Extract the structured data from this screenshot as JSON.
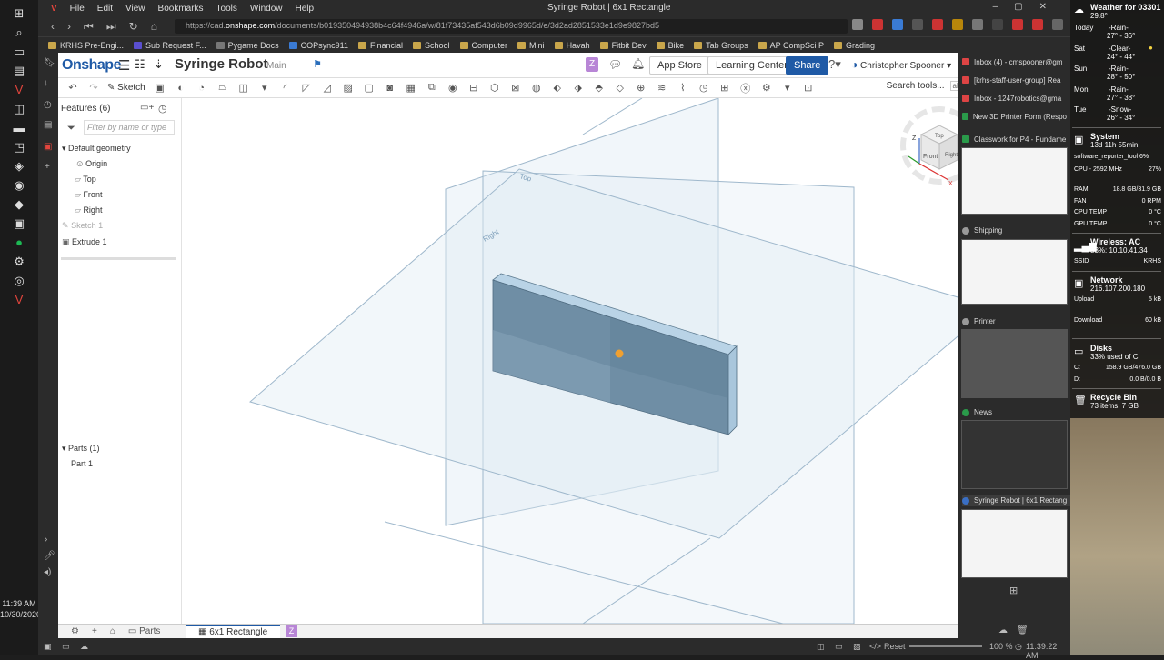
{
  "taskbar": {
    "clock_time": "11:39 AM",
    "clock_date": "10/30/2020"
  },
  "browser": {
    "menu": [
      "File",
      "Edit",
      "View",
      "Bookmarks",
      "Tools",
      "Window",
      "Help"
    ],
    "window_title": "Syringe Robot | 6x1 Rectangle",
    "url_prefix": "https://cad.",
    "url_domain": "onshape.com",
    "url_path": "/documents/b019350494938b4c64f4946a/w/81f73435af543d6b09d9965d/e/3d2ad2851533e1d9e9827bd5",
    "bookmarks": [
      "KRHS Pre-Engi...",
      "Sub Request F...",
      "Pygame Docs",
      "COPsync911",
      "Financial",
      "School",
      "Computer",
      "Mini",
      "Havah",
      "Fitbit Dev",
      "Bike",
      "Tab Groups",
      "AP CompSci P",
      "Grading"
    ]
  },
  "onshape": {
    "logo": "Onshape",
    "doc_title": "Syringe Robot",
    "branch": "Main",
    "z_badge": "Z",
    "app_store": "App Store",
    "learning_center": "Learning Center",
    "share": "Share",
    "user": "Christopher Spooner",
    "sketch": "Sketch",
    "search_tools": "Search tools...",
    "search_shortcut": "alt C"
  },
  "features": {
    "title": "Features (6)",
    "filter_placeholder": "Filter by name or type",
    "default_geometry": "Default geometry",
    "origin": "Origin",
    "top": "Top",
    "front": "Front",
    "right": "Right",
    "sketch1": "Sketch 1",
    "extrude1": "Extrude 1",
    "parts_header": "Parts (1)",
    "part1": "Part 1"
  },
  "viewport": {
    "plane_top": "Top",
    "plane_right": "Right",
    "cube_top": "Top",
    "cube_front": "Front",
    "cube_right": "Right",
    "axis_z": "Z",
    "axis_x": "X"
  },
  "bottom": {
    "parts_tab": "Parts",
    "active_tab": "6x1 Rectangle",
    "z_badge": "Z"
  },
  "status": {
    "reset": "Reset",
    "zoom": "100 %",
    "time": "11:39:22 AM"
  },
  "tab_panel": {
    "items": [
      "Inbox (4) - cmspooner@gm",
      "[krhs-staff-user-group] Rea",
      "Inbox - 1247robotics@gma",
      "New 3D Printer Form (Respo",
      "Classwork for P4 - Fundame"
    ],
    "groups": [
      "Shipping",
      "Printer",
      "News",
      "Syringe Robot | 6x1 Rectang"
    ]
  },
  "weather": {
    "title": "Weather for 03301",
    "temp": "29.8°",
    "days": [
      {
        "day": "Today",
        "cond": "-Rain-",
        "range": "27° - 36°"
      },
      {
        "day": "Sat",
        "cond": "-Clear-",
        "range": "24° - 44°"
      },
      {
        "day": "Sun",
        "cond": "-Rain-",
        "range": "28° - 50°"
      },
      {
        "day": "Mon",
        "cond": "-Rain-",
        "range": "27° - 38°"
      },
      {
        "day": "Tue",
        "cond": "-Snow-",
        "range": "26° - 34°"
      }
    ]
  },
  "system": {
    "title": "System",
    "uptime": "13d 11h 55min",
    "process": "software_reporter_tool 6%",
    "cpu_label": "CPU - 2592 MHz",
    "cpu_val": "27%",
    "ram_label": "RAM",
    "ram_val": "18.8 GB/31.9 GB",
    "fan_label": "FAN",
    "fan_val": "0 RPM",
    "cputemp_label": "CPU TEMP",
    "cputemp_val": "0 °C",
    "gputemp_label": "GPU TEMP",
    "gputemp_val": "0 °C"
  },
  "wireless": {
    "title": "Wireless: AC",
    "sub": "83%: 10.10.41.34",
    "ssid_label": "SSID",
    "ssid_val": "KRHS"
  },
  "network": {
    "title": "Network",
    "ip": "216.107.200.180",
    "up_label": "Upload",
    "up_val": "5 kB",
    "down_label": "Download",
    "down_val": "60 kB"
  },
  "disks": {
    "title": "Disks",
    "sub": "33% used of C:",
    "c_label": "C:",
    "c_val": "158.9 GB/476.0 GB",
    "d_label": "D:",
    "d_val": "0.0 B/0.0 B"
  },
  "recycle": {
    "title": "Recycle Bin",
    "sub": "73 items, 7 GB"
  }
}
